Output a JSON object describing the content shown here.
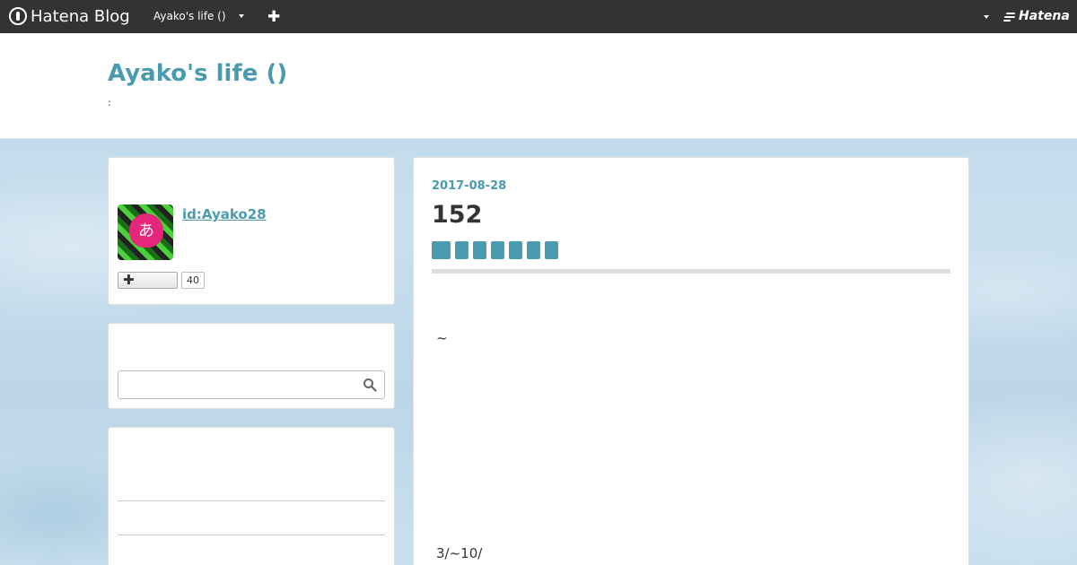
{
  "global_header": {
    "logo_text": "Hatena Blog",
    "blog_name": "Ayako's life ()",
    "add_icon": "plus-icon",
    "brand": "Hatena"
  },
  "blog": {
    "title": "Ayako's life ()",
    "description": ":"
  },
  "sidebar": {
    "profile": {
      "user_id": "id:Ayako28",
      "avatar_glyph": "あ",
      "follow_count": "40",
      "follow_icon": "plus-icon"
    },
    "search": {
      "placeholder": "",
      "icon": "search-icon"
    }
  },
  "entry": {
    "date": "2017-08-28",
    "title": "152",
    "category_count": 7,
    "body_line_1": "~",
    "body_line_2": "3/~10/"
  },
  "colors": {
    "accent": "#4a9bb0",
    "header_bg": "#333333",
    "tag_bg": "#4a9bb0"
  }
}
